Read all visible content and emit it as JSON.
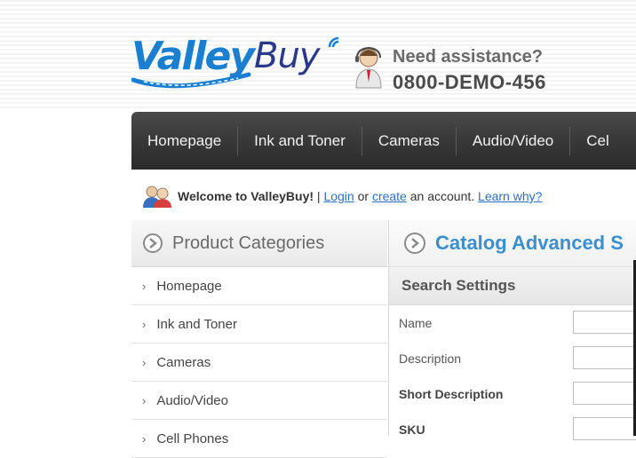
{
  "brand": {
    "logo_part1": "Valley",
    "logo_part2": "Buy",
    "colors": {
      "primary": "#1a7fd0",
      "dark_blue": "#2a3a8a",
      "nav_bg": "#333333",
      "link": "#2a6fc9"
    }
  },
  "assistance": {
    "title": "Need assistance?",
    "phone": "0800-DEMO-456"
  },
  "nav": {
    "items": [
      "Homepage",
      "Ink and Toner",
      "Cameras",
      "Audio/Video",
      "Cel"
    ]
  },
  "welcome": {
    "brand_text": "Welcome to ValleyBuy!",
    "separator": "|",
    "login": "Login",
    "or": "or",
    "create": "create",
    "an_account": "an account.",
    "learn_why": "Learn why?"
  },
  "sidebar": {
    "title": "Product Categories",
    "items": [
      "Homepage",
      "Ink and Toner",
      "Cameras",
      "Audio/Video",
      "Cell Phones"
    ]
  },
  "main": {
    "title": "Catalog Advanced S",
    "section": "Search Settings",
    "fields": [
      {
        "label": "Name",
        "value": ""
      },
      {
        "label": "Description",
        "value": ""
      },
      {
        "label": "Short Description",
        "value": ""
      },
      {
        "label": "SKU",
        "value": ""
      }
    ]
  }
}
